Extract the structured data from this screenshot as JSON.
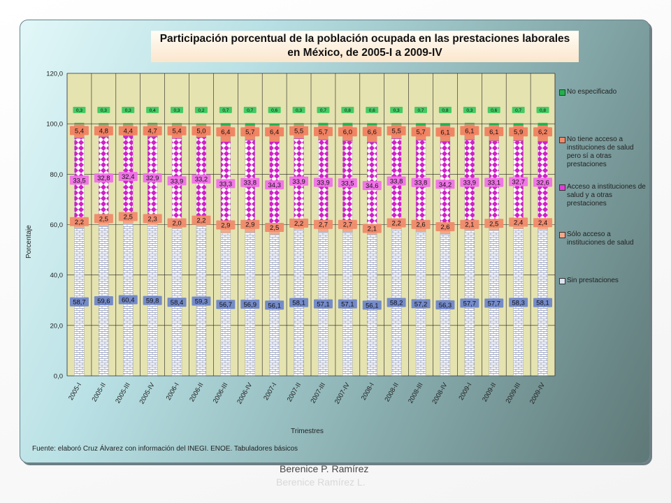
{
  "slide": {
    "watermark_line1": "Berenice P. Ramírez",
    "watermark_line2": "Berenice Ramírez L."
  },
  "chart_data": {
    "type": "bar",
    "stacked": true,
    "title": "Participación porcentual de la población ocupada en las prestaciones laborales en México, de 2005-I a 2009-IV",
    "title_line1": "Participación porcentual de la población ocupada en las prestaciones laborales",
    "title_line2": "en México, de 2005-I a 2009-IV",
    "xlabel": "Trimestres",
    "ylabel": "Porcentaje",
    "ylim": [
      0,
      120
    ],
    "yticks": [
      "0,0",
      "20,0",
      "40,0",
      "60,0",
      "80,0",
      "100,0",
      "120,0"
    ],
    "grid": true,
    "legend_position": "right",
    "source_note": "Fuente: elaboró Cruz Álvarez con información del INEGI. ENOE. Tabuladores básicos",
    "categories": [
      "2005-I",
      "2005-II",
      "2005-III",
      "2005-IV",
      "2006-I",
      "2006-II",
      "2006-III",
      "2006-IV",
      "2007-I",
      "2007-II",
      "2007-III",
      "2007-IV",
      "2008-I",
      "2008-II",
      "2008-III",
      "2008-IV",
      "2009-I",
      "2009-II",
      "2009-III",
      "2009-IV"
    ],
    "series": [
      {
        "name": "Sin prestaciones",
        "color": "#dde3f0",
        "label_color": "#6f86c8",
        "values": [
          58.7,
          59.6,
          60.4,
          59.8,
          58.4,
          59.3,
          56.7,
          56.9,
          56.1,
          58.1,
          57.1,
          57.1,
          56.1,
          58.2,
          57.2,
          56.3,
          57.7,
          57.7,
          58.3,
          58.1
        ],
        "labels": [
          "58,7",
          "59,6",
          "60,4",
          "59,8",
          "58,4",
          "59,3",
          "56,7",
          "56,9",
          "56,1",
          "58,1",
          "57,1",
          "57,1",
          "56,1",
          "58,2",
          "57,2",
          "56,3",
          "57,7",
          "57,7",
          "58,3",
          "58,1"
        ]
      },
      {
        "name": "Sólo acceso a instituciones de salud",
        "color": "#f4a888",
        "label_color": "#f08a6a",
        "values": [
          2.2,
          2.5,
          2.5,
          2.3,
          2.0,
          2.2,
          2.9,
          2.9,
          2.5,
          2.2,
          2.7,
          2.7,
          2.1,
          2.2,
          2.6,
          2.6,
          2.1,
          2.5,
          2.4,
          2.4
        ],
        "labels": [
          "2,2",
          "2,5",
          "2,5",
          "2,3",
          "2,0",
          "2,2",
          "2,9",
          "2,9",
          "2,5",
          "2,2",
          "2,7",
          "2,7",
          "2,1",
          "2,2",
          "2,6",
          "2,6",
          "2,1",
          "2,5",
          "2,4",
          "2,4"
        ]
      },
      {
        "name": "Acceso a instituciones de salud y a otras prestaciones",
        "color": "#d020c8",
        "label_color": "#f070e8",
        "values": [
          33.5,
          32.8,
          32.4,
          32.9,
          33.9,
          33.2,
          33.3,
          33.8,
          34.3,
          33.9,
          33.9,
          33.5,
          34.6,
          33.8,
          33.8,
          34.2,
          33.9,
          33.1,
          32.7,
          32.6
        ],
        "labels": [
          "33,5",
          "32,8",
          "32,4",
          "32,9",
          "33,9",
          "33,2",
          "33,3",
          "33,8",
          "34,3",
          "33,9",
          "33,9",
          "33,5",
          "34,6",
          "33,8",
          "33,8",
          "34,2",
          "33,9",
          "33,1",
          "32,7",
          "32,6"
        ]
      },
      {
        "name": "No tiene acceso a instituciones de salud pero sí a otras prestaciones",
        "color": "#f08a6a",
        "label_color": "#f08060",
        "values": [
          5.4,
          4.8,
          4.4,
          4.7,
          5.4,
          5.0,
          6.4,
          5.7,
          6.4,
          5.5,
          5.7,
          6.0,
          6.6,
          5.5,
          5.7,
          6.1,
          6.1,
          6.1,
          5.9,
          6.2
        ],
        "labels": [
          "5,4",
          "4,8",
          "4,4",
          "4,7",
          "5,4",
          "5,0",
          "6,4",
          "5,7",
          "6,4",
          "5,5",
          "5,7",
          "6,0",
          "6,6",
          "5,5",
          "5,7",
          "6,1",
          "6,1",
          "6,1",
          "5,9",
          "6,2"
        ]
      },
      {
        "name": "No especificado",
        "color": "#22b14c",
        "label_color": "#3cc860",
        "values": [
          0.3,
          0.3,
          0.3,
          0.4,
          0.3,
          0.2,
          0.7,
          0.7,
          0.6,
          0.3,
          0.7,
          0.8,
          0.6,
          0.3,
          0.7,
          0.8,
          0.3,
          0.6,
          0.7,
          0.8
        ],
        "labels": [
          "0,3",
          "0,3",
          "0,3",
          "0,4",
          "0,3",
          "0,2",
          "0,7",
          "0,7",
          "0,6",
          "0,3",
          "0,7",
          "0,8",
          "0,6",
          "0,3",
          "0,7",
          "0,8",
          "0,3",
          "0,6",
          "0,7",
          "0,8"
        ]
      }
    ]
  }
}
